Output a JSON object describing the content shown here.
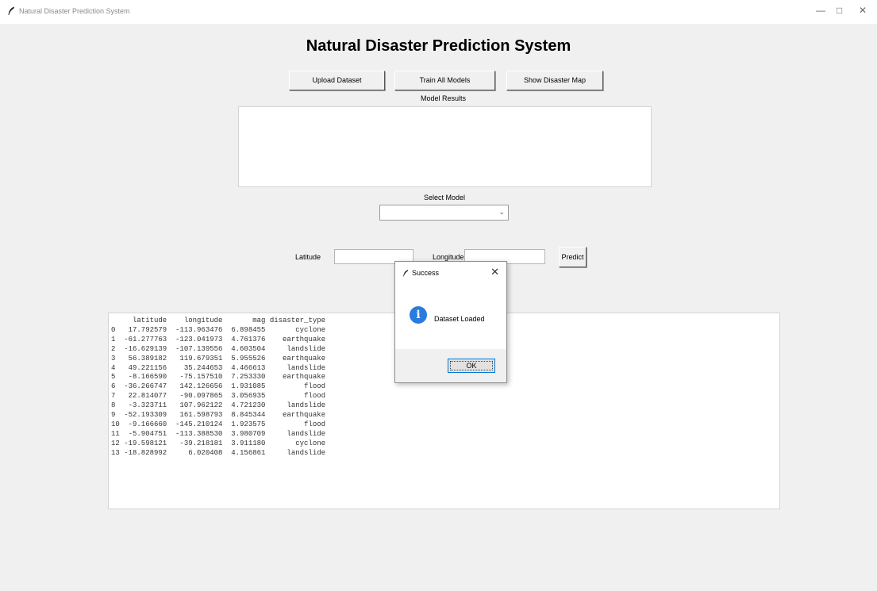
{
  "window": {
    "title": "Natural Disaster Prediction System",
    "controls": {
      "minimize": "—",
      "maximize": "□",
      "close": "✕"
    }
  },
  "header": {
    "title": "Natural Disaster Prediction System"
  },
  "toolbar": {
    "upload_label": "Upload Dataset",
    "train_label": "Train All Models",
    "map_label": "Show Disaster Map"
  },
  "results": {
    "label": "Model Results",
    "value": ""
  },
  "model_select": {
    "label": "Select Model",
    "value": ""
  },
  "predict_form": {
    "latitude_label": "Latitude",
    "latitude_value": "",
    "longitude_label": "Longitude",
    "longitude_value": "",
    "predict_label": "Predict"
  },
  "dataset": {
    "columns": [
      "latitude",
      "longitude",
      "mag",
      "disaster_type"
    ],
    "rows": [
      {
        "index": "0",
        "latitude": "17.792579",
        "longitude": "-113.963476",
        "mag": "6.898455",
        "disaster_type": "cyclone"
      },
      {
        "index": "1",
        "latitude": "-61.277763",
        "longitude": "-123.041973",
        "mag": "4.761376",
        "disaster_type": "earthquake"
      },
      {
        "index": "2",
        "latitude": "-16.629139",
        "longitude": "-107.139556",
        "mag": "4.603504",
        "disaster_type": "landslide"
      },
      {
        "index": "3",
        "latitude": "56.389182",
        "longitude": "119.679351",
        "mag": "5.955526",
        "disaster_type": "earthquake"
      },
      {
        "index": "4",
        "latitude": "49.221156",
        "longitude": "35.244653",
        "mag": "4.466613",
        "disaster_type": "landslide"
      },
      {
        "index": "5",
        "latitude": "-8.166590",
        "longitude": "-75.157510",
        "mag": "7.253330",
        "disaster_type": "earthquake"
      },
      {
        "index": "6",
        "latitude": "-36.266747",
        "longitude": "142.126656",
        "mag": "1.931085",
        "disaster_type": "flood"
      },
      {
        "index": "7",
        "latitude": "22.814077",
        "longitude": "-90.097865",
        "mag": "3.056935",
        "disaster_type": "flood"
      },
      {
        "index": "8",
        "latitude": "-3.323711",
        "longitude": "107.962122",
        "mag": "4.721230",
        "disaster_type": "landslide"
      },
      {
        "index": "9",
        "latitude": "-52.193309",
        "longitude": "161.598793",
        "mag": "8.845344",
        "disaster_type": "earthquake"
      },
      {
        "index": "10",
        "latitude": "-9.166660",
        "longitude": "-145.210124",
        "mag": "1.923575",
        "disaster_type": "flood"
      },
      {
        "index": "11",
        "latitude": "-5.904751",
        "longitude": "-113.388530",
        "mag": "3.980709",
        "disaster_type": "landslide"
      },
      {
        "index": "12",
        "latitude": "-19.598121",
        "longitude": "-39.218181",
        "mag": "3.911180",
        "disaster_type": "cyclone"
      },
      {
        "index": "13",
        "latitude": "-18.828992",
        "longitude": "6.020408",
        "mag": "4.156861",
        "disaster_type": "landslide"
      }
    ]
  },
  "dialog": {
    "title": "Success",
    "message": "Dataset Loaded",
    "ok_label": "OK",
    "close_glyph": "✕",
    "info_glyph": "i"
  },
  "icons": {
    "app": "feather-icon",
    "info": "info-icon"
  },
  "colors": {
    "info_icon": "#2a7bde",
    "button_focus": "#0078d7"
  }
}
